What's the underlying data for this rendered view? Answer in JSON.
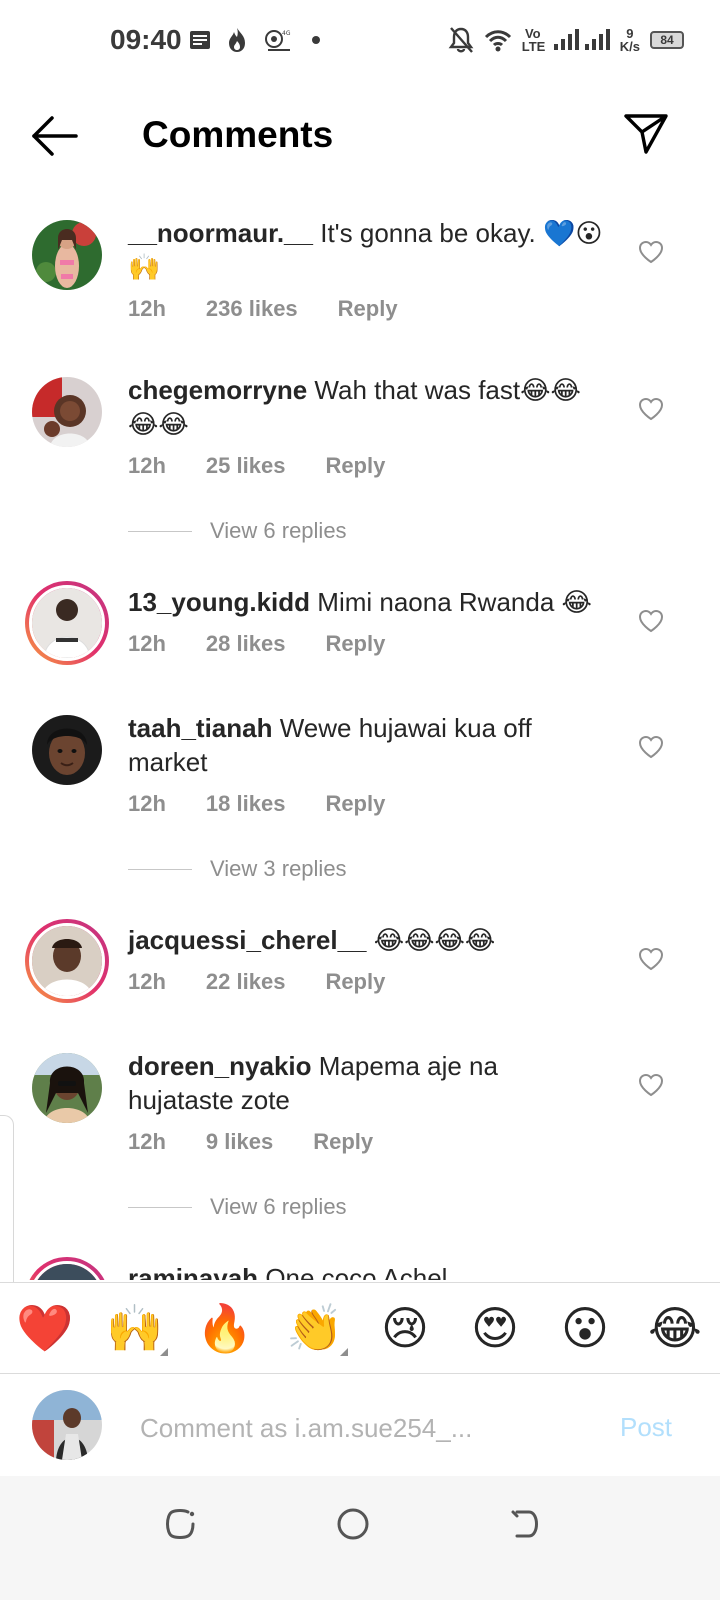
{
  "status_bar": {
    "time": "09:40",
    "network_type": "Vo LTE",
    "speed_value": "9",
    "speed_unit": "K/s",
    "battery": "84",
    "icons": [
      "notes-icon",
      "fire-icon",
      "app-icon",
      "dot-icon",
      "mute-icon",
      "wifi-icon",
      "signal-icon"
    ]
  },
  "header": {
    "title": "Comments",
    "back_icon": "arrow-left-icon",
    "share_icon": "send-icon"
  },
  "comments": [
    {
      "user": "__noormaur.__",
      "text": "It's gonna be okay. 💙😮🙌",
      "time": "12h",
      "likes": "236 likes",
      "reply": "Reply",
      "story_ring": false,
      "view_replies": ""
    },
    {
      "user": "chegemorryne",
      "text": "Wah that was fast😂😂😂😂",
      "time": "12h",
      "likes": "25 likes",
      "reply": "Reply",
      "story_ring": false,
      "view_replies": "View 6 replies"
    },
    {
      "user": "13_young.kidd",
      "text": "Mimi naona Rwanda 😂",
      "time": "12h",
      "likes": "28 likes",
      "reply": "Reply",
      "story_ring": true,
      "view_replies": ""
    },
    {
      "user": "taah_tianah",
      "text": "Wewe hujawai kua off market",
      "time": "12h",
      "likes": "18 likes",
      "reply": "Reply",
      "story_ring": false,
      "view_replies": "View 3 replies"
    },
    {
      "user": "jacquessi_cherel__",
      "text": "😂😂😂😂",
      "time": "12h",
      "likes": "22 likes",
      "reply": "Reply",
      "story_ring": true,
      "view_replies": ""
    },
    {
      "user": "doreen_nyakio",
      "text": "Mapema aje na hujataste zote",
      "time": "12h",
      "likes": "9 likes",
      "reply": "Reply",
      "story_ring": false,
      "view_replies": "View 6 replies"
    },
    {
      "user": "raminayah",
      "text": "One coco Achel",
      "time": "",
      "likes": "",
      "reply": "",
      "story_ring": true,
      "view_replies": ""
    }
  ],
  "emoji_bar": [
    "❤️",
    "🙌",
    "🔥",
    "👏",
    "😢",
    "😍",
    "😮",
    "😂"
  ],
  "composer": {
    "placeholder": "Comment as i.am.sue254_...",
    "post_label": "Post"
  },
  "nav_bar": {
    "icons": [
      "recents-icon",
      "home-icon",
      "back-nav-icon"
    ]
  },
  "colors": {
    "meta_gray": "#8e8e8e",
    "post_disabled": "#b2dffc",
    "ring_start": "#f9a03f",
    "ring_end": "#c13584"
  }
}
